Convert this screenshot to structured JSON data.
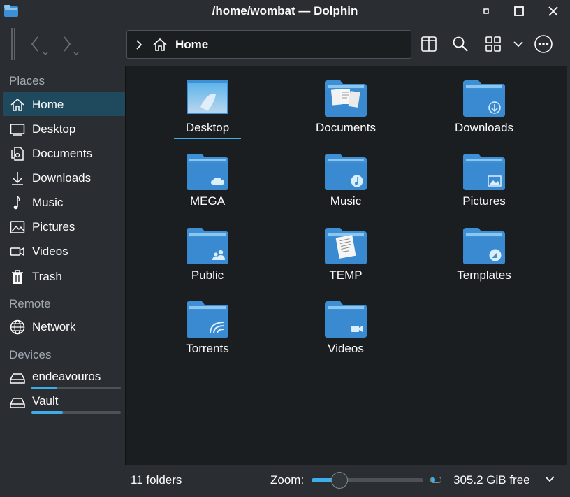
{
  "window": {
    "title": "/home/wombat — Dolphin"
  },
  "toolbar": {
    "location": "Home"
  },
  "sidebar": {
    "places_header": "Places",
    "places": [
      {
        "label": "Home",
        "icon": "home-icon",
        "active": true
      },
      {
        "label": "Desktop",
        "icon": "desktop-icon"
      },
      {
        "label": "Documents",
        "icon": "documents-icon"
      },
      {
        "label": "Downloads",
        "icon": "downloads-icon"
      },
      {
        "label": "Music",
        "icon": "music-icon"
      },
      {
        "label": "Pictures",
        "icon": "pictures-icon"
      },
      {
        "label": "Videos",
        "icon": "videos-icon"
      },
      {
        "label": "Trash",
        "icon": "trash-icon"
      }
    ],
    "remote_header": "Remote",
    "remote": [
      {
        "label": "Network",
        "icon": "network-icon"
      }
    ],
    "devices_header": "Devices",
    "devices": [
      {
        "label": "endeavouros",
        "icon": "drive-icon",
        "usage": 0.28
      },
      {
        "label": "Vault",
        "icon": "drive-icon",
        "usage": 0.35
      }
    ]
  },
  "files": [
    {
      "name": "Desktop",
      "emblem": "desktop",
      "selected": true
    },
    {
      "name": "Documents",
      "emblem": "documents"
    },
    {
      "name": "Downloads",
      "emblem": "download"
    },
    {
      "name": "MEGA",
      "emblem": "cloud"
    },
    {
      "name": "Music",
      "emblem": "music"
    },
    {
      "name": "Pictures",
      "emblem": "picture"
    },
    {
      "name": "Public",
      "emblem": "users"
    },
    {
      "name": "TEMP",
      "emblem": "paper"
    },
    {
      "name": "Templates",
      "emblem": "template"
    },
    {
      "name": "Torrents",
      "emblem": "torrent"
    },
    {
      "name": "Videos",
      "emblem": "video"
    }
  ],
  "status": {
    "count": "11 folders",
    "zoom_label": "Zoom:",
    "zoom_level": 0.25,
    "free_space": "305.2 GiB free"
  },
  "colors": {
    "accent": "#3daee9",
    "folder": "#3d8fd6",
    "folder_tab": "#8cc6ef",
    "selection": "#1f4a5e"
  }
}
